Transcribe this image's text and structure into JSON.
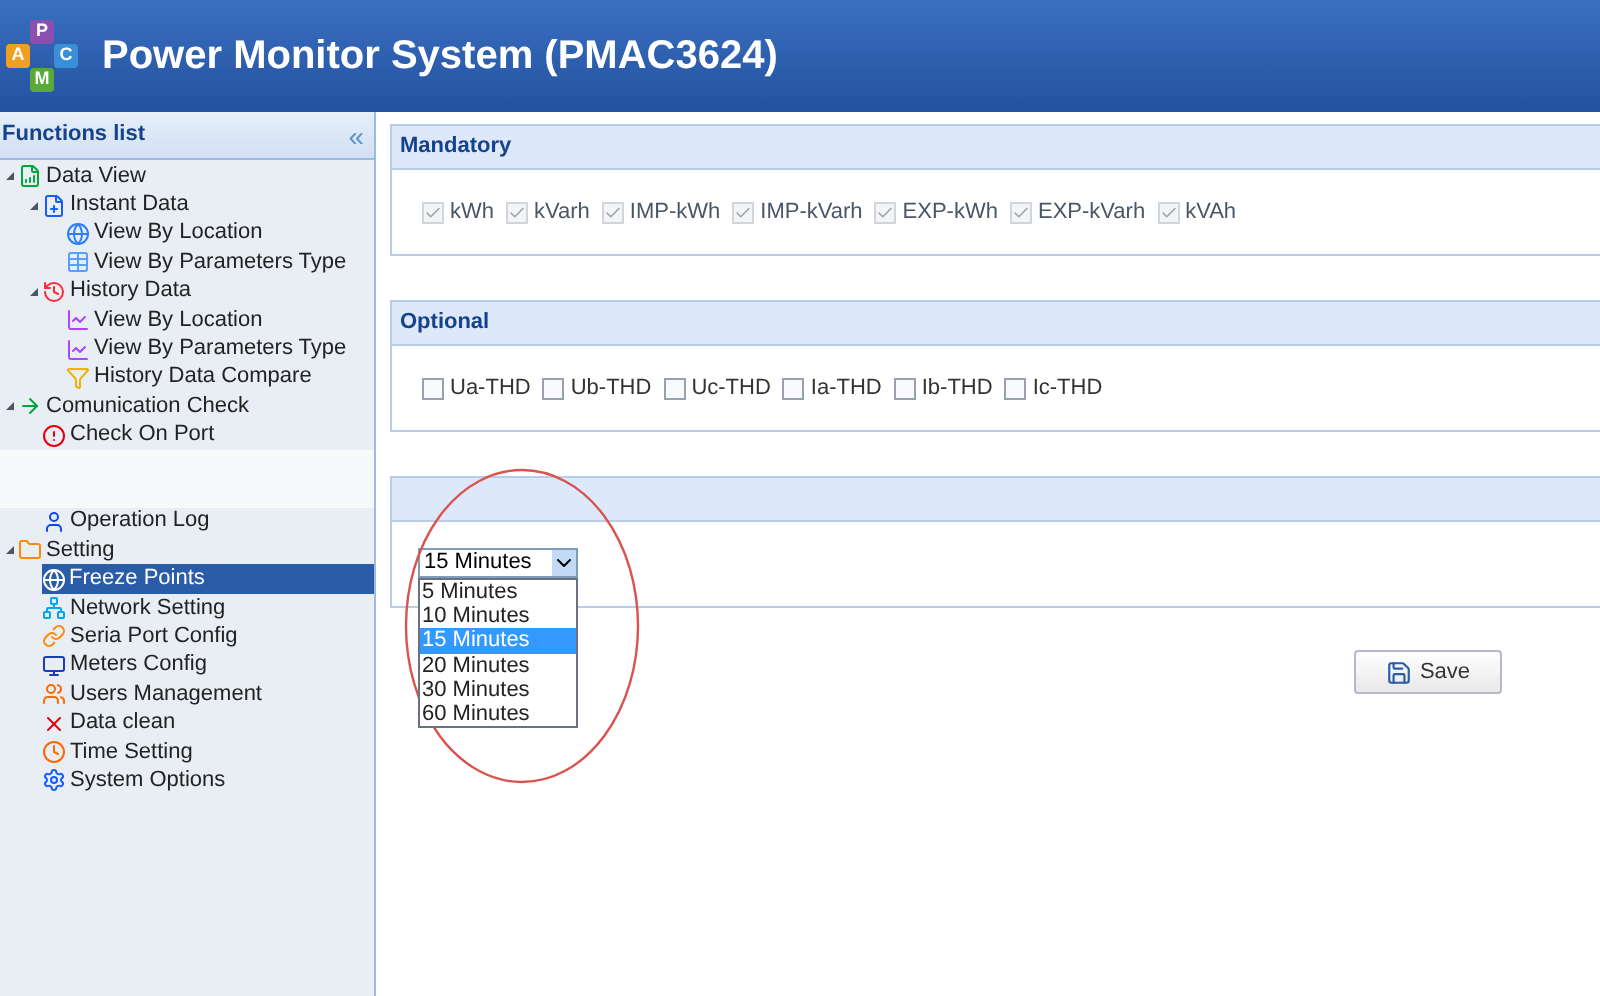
{
  "header": {
    "logo_letters": [
      "P",
      "A",
      "C",
      "M"
    ],
    "title": "Power Monitor System (PMAC3624)"
  },
  "sidebar": {
    "title": "Functions list",
    "collapse": "«",
    "items": [
      {
        "label": "Data View",
        "expanded": true,
        "selected": false,
        "children": [
          {
            "label": "Instant Data",
            "expanded": true,
            "selected": false,
            "children": [
              {
                "label": "View By Location",
                "selected": false
              },
              {
                "label": "View By Parameters Type",
                "selected": false
              }
            ]
          },
          {
            "label": "History Data",
            "expanded": true,
            "selected": false,
            "children": [
              {
                "label": "View By Location",
                "selected": false
              },
              {
                "label": "View By Parameters Type",
                "selected": false
              },
              {
                "label": "History Data Compare",
                "selected": false
              }
            ]
          }
        ]
      },
      {
        "label": "Comunication Check",
        "expanded": true,
        "selected": false,
        "children": [
          {
            "label": "Check On Port",
            "selected": false
          },
          {
            "kind": "blurred"
          },
          {
            "kind": "blurred"
          },
          {
            "label": "Operation Log",
            "selected": false
          }
        ]
      },
      {
        "label": "Setting",
        "expanded": true,
        "selected": false,
        "children": [
          {
            "label": "Freeze Points",
            "selected": true
          },
          {
            "label": "Network Setting",
            "selected": false
          },
          {
            "label": "Seria Port Config",
            "selected": false
          },
          {
            "label": "Meters Config",
            "selected": false
          },
          {
            "label": "Users Management",
            "selected": false
          },
          {
            "label": "Data clean",
            "selected": false
          },
          {
            "label": "Time Setting",
            "selected": false
          },
          {
            "label": "System Options",
            "selected": false
          }
        ]
      }
    ]
  },
  "panels": [
    {
      "title": "Mandatory",
      "kind": "checks",
      "options": [
        {
          "label": "kWh",
          "checked": true,
          "disabled": true
        },
        {
          "label": "kVarh",
          "checked": true,
          "disabled": true
        },
        {
          "label": "IMP-kWh",
          "checked": true,
          "disabled": true
        },
        {
          "label": "IMP-kVarh",
          "checked": true,
          "disabled": true
        },
        {
          "label": "EXP-kWh",
          "checked": true,
          "disabled": true
        },
        {
          "label": "EXP-kVarh",
          "checked": true,
          "disabled": true
        },
        {
          "label": "kVAh",
          "checked": true,
          "disabled": true
        }
      ]
    },
    {
      "title": "Optional",
      "kind": "checks",
      "options": [
        {
          "label": "Ua-THD",
          "checked": false,
          "disabled": false
        },
        {
          "label": "Ub-THD",
          "checked": false,
          "disabled": false
        },
        {
          "label": "Uc-THD",
          "checked": false,
          "disabled": false
        },
        {
          "label": "Ia-THD",
          "checked": false,
          "disabled": false
        },
        {
          "label": "Ib-THD",
          "checked": false,
          "disabled": false
        },
        {
          "label": "Ic-THD",
          "checked": false,
          "disabled": false
        }
      ]
    },
    {
      "kind": "select",
      "value": "15 Minutes",
      "expanded": true,
      "options": [
        {
          "label": "5 Minutes",
          "selected": false
        },
        {
          "label": "10 Minutes",
          "selected": false
        },
        {
          "label": "15 Minutes",
          "selected": true
        },
        {
          "label": "20 Minutes",
          "selected": false
        },
        {
          "label": "30 Minutes",
          "selected": false
        },
        {
          "label": "60 Minutes",
          "selected": false
        }
      ]
    }
  ],
  "save_button": "Save"
}
